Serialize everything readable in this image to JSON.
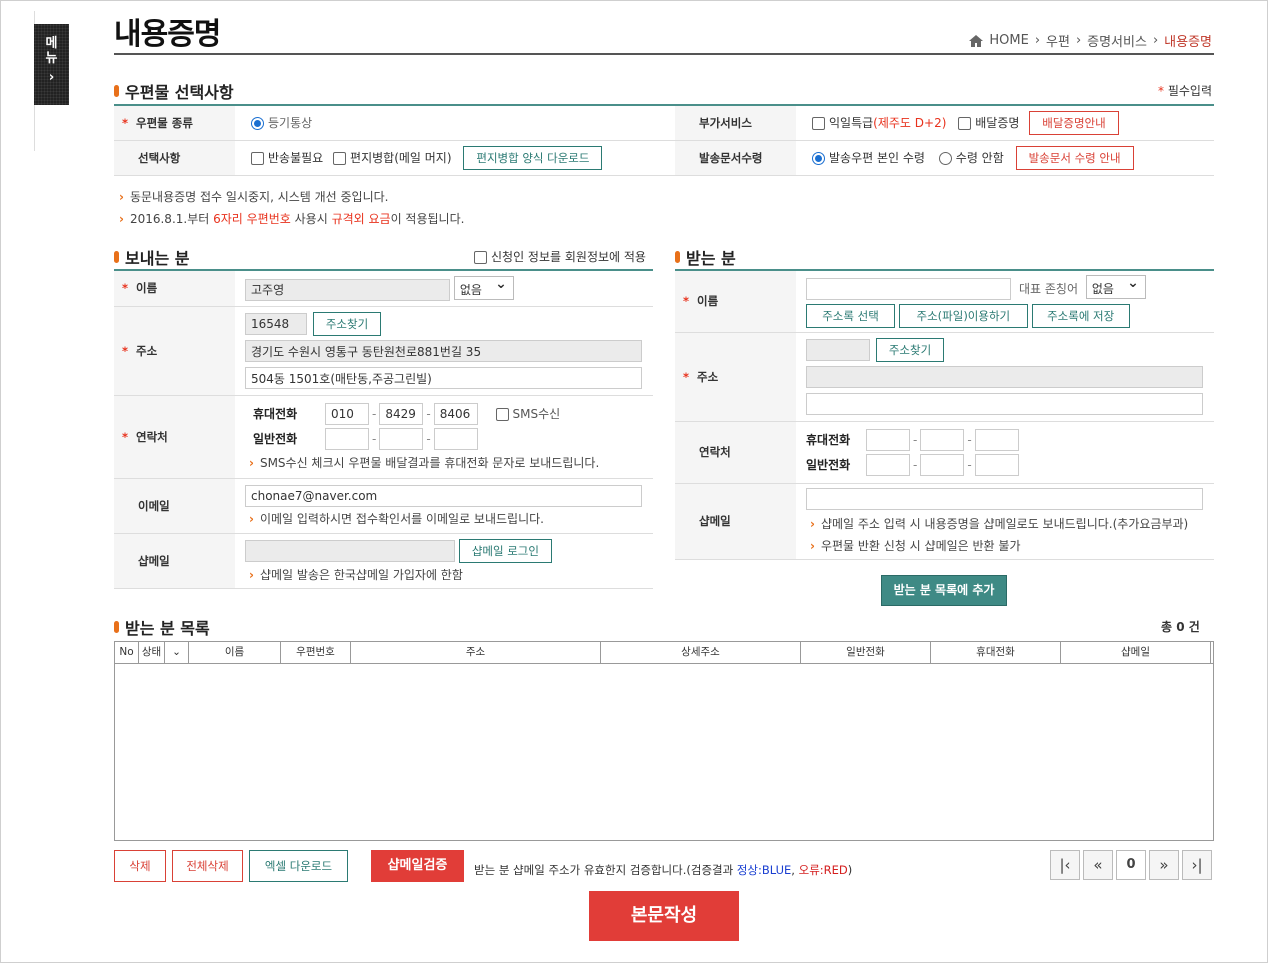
{
  "menu": {
    "label1": "메",
    "label2": "뉴",
    "arrow": "›"
  },
  "page": {
    "title": "내용증명"
  },
  "breadcrumb": {
    "home": "HOME",
    "l1": "우편",
    "l2": "증명서비스",
    "l3": "내용증명",
    "sep": "›"
  },
  "selection": {
    "title": "우편물 선택사항",
    "required_note": "필수입력",
    "mail_type_label": "우편물 종류",
    "mail_type_value": "등기통상",
    "extra_label": "부가서비스",
    "extra_opt1": "익일특급",
    "extra_opt1_note": "(제주도 D+2)",
    "extra_opt2": "배달증명",
    "extra_btn": "배달증명안내",
    "options_label": "선택사항",
    "opt1": "반송불필요",
    "opt2": "편지병합(메일 머지)",
    "opt_btn": "편지병합 양식 다운로드",
    "receipt_label": "발송문서수령",
    "receipt_opt1": "발송우편 본인 수령",
    "receipt_opt2": "수령 안함",
    "receipt_btn": "발송문서 수령 안내"
  },
  "notices": {
    "n1": "동문내용증명 접수 일시중지, 시스템 개선 중입니다.",
    "n2_a": "2016.8.1.부터 ",
    "n2_b": "6자리 우편번호",
    "n2_c": " 사용시 ",
    "n2_d": "규격외 요금",
    "n2_e": "이 적용됩니다."
  },
  "sender": {
    "title": "보내는 분",
    "apply_label": "신청인 정보를 회원정보에 적용",
    "name_label": "이름",
    "name_value": "고주영",
    "name_select": "없음",
    "addr_label": "주소",
    "zip": "16548",
    "find_addr": "주소찾기",
    "addr1": "경기도 수원시 영통구 동탄원천로881번길 35",
    "addr2": "504동 1501호(매탄동,주공그린빌)",
    "contact_label": "연락처",
    "mobile_label": "휴대전화",
    "m1": "010",
    "m2": "8429",
    "m3": "8406",
    "sms": "SMS수신",
    "phone_label": "일반전화",
    "contact_note": "SMS수신 체크시 우편물 배달결과를 휴대전화 문자로 보내드립니다.",
    "email_label": "이메일",
    "email_value": "chonae7@naver.com",
    "email_note": "이메일 입력하시면 접수확인서를 이메일로 보내드립니다.",
    "shap_label": "샵메일",
    "shap_btn": "샵메일 로그인",
    "shap_note": "샵메일 발송은 한국샵메일 가입자에 한함"
  },
  "receiver": {
    "title": "받는 분",
    "name_label": "이름",
    "honorific_label": "대표 존칭어",
    "honorific_select": "없음",
    "btn_addrbook": "주소록 선택",
    "btn_file": "주소(파일)이용하기",
    "btn_save": "주소록에 저장",
    "addr_label": "주소",
    "find_addr": "주소찾기",
    "contact_label": "연락처",
    "mobile_label": "휴대전화",
    "phone_label": "일반전화",
    "shap_label": "샵메일",
    "shap_note1": "샵메일 주소 입력 시 내용증명을 샵메일로도 보내드립니다.(추가요금부과)",
    "shap_note2": "우편물 반환 신청 시 샵메일은 반환 불가",
    "add_btn": "받는 분 목록에 추가"
  },
  "list": {
    "title": "받는 분 목록",
    "total": "총 0 건",
    "columns": [
      "No",
      "상태",
      "",
      "이름",
      "우편번호",
      "주소",
      "상세주소",
      "일반전화",
      "휴대전화",
      "샵메일"
    ]
  },
  "actions": {
    "delete": "삭제",
    "delete_all": "전체삭제",
    "excel": "엑셀 다운로드",
    "verify": "샵메일검증",
    "verify_note_a": "받는 분 샵메일 주소가 유효한지 검증합니다.(검증결과 ",
    "verify_ok": "정상:BLUE",
    ", ": "",
    "verify_sep": ", ",
    "verify_err": "오류:RED",
    "verify_end": ")",
    "page_num": "0",
    "compose": "본문작성"
  }
}
